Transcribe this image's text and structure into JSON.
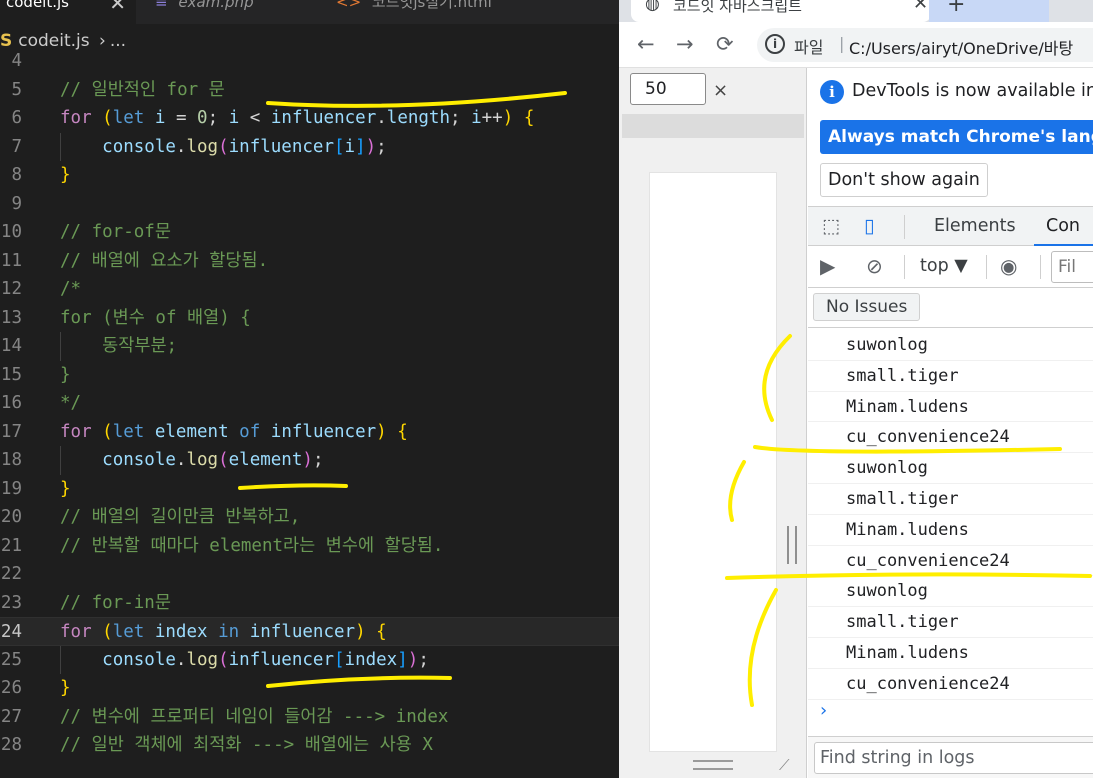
{
  "editor": {
    "tabs": [
      {
        "label": "codeit.js",
        "close": "✕",
        "active": true
      },
      {
        "label": "exam.php",
        "icon": "php-icon",
        "active": false
      },
      {
        "label": "코드잇js실기.html",
        "icon": "html-icon",
        "active": false
      }
    ],
    "breadcrumb": {
      "file": "codeit.js",
      "sep": "›",
      "rest": "..."
    },
    "lines": [
      {
        "n": "4"
      },
      {
        "n": "5"
      },
      {
        "n": "6"
      },
      {
        "n": "7"
      },
      {
        "n": "8"
      },
      {
        "n": "9"
      },
      {
        "n": "10"
      },
      {
        "n": "11"
      },
      {
        "n": "12"
      },
      {
        "n": "13"
      },
      {
        "n": "14"
      },
      {
        "n": "15"
      },
      {
        "n": "16"
      },
      {
        "n": "17"
      },
      {
        "n": "18"
      },
      {
        "n": "19"
      },
      {
        "n": "20"
      },
      {
        "n": "21"
      },
      {
        "n": "22"
      },
      {
        "n": "23"
      },
      {
        "n": "24"
      },
      {
        "n": "25"
      },
      {
        "n": "26"
      },
      {
        "n": "27"
      },
      {
        "n": "28"
      }
    ],
    "code": {
      "c5": "// 일반적인 for 문",
      "c10": "// for-of문",
      "c11": "// 배열에 요소가 할당됨.",
      "c12": "/*",
      "c13": "for (변수 of 배열) {",
      "c14": "    동작부분;",
      "c15": "}",
      "c16": "*/",
      "c20": "// 배열의 길이만큼 반복하고,",
      "c21": "// 반복할 때마다 element라는 변수에 할당됨.",
      "c23": "// for-in문",
      "c27": "// 변수에 프로퍼티 네임이 들어감 ---> index",
      "c28": "// 일반 객체에 최적화 ---> 배열에는 사용 X"
    }
  },
  "browser": {
    "tab_title": "코드잇 자바스크립트",
    "tab_close": "✕",
    "new_tab": "+",
    "nav": {
      "back": "←",
      "forward": "→",
      "reload": "⟳"
    },
    "url_label": "파일",
    "url": "C:/Users/airyt/OneDrive/바탕",
    "zoom": "50",
    "zoom_close": "×"
  },
  "devtools": {
    "notice": "DevTools is now available in",
    "match_button": "Always match Chrome's langu",
    "dont_show": "Don't show again",
    "tabs": [
      "Elements",
      "Con"
    ],
    "context": "top ▼",
    "filter_placeholder": "Fil",
    "issues": "No Issues",
    "logs": [
      "suwonlog",
      "small.tiger",
      "Minam.ludens",
      "cu_convenience24",
      "suwonlog",
      "small.tiger",
      "Minam.ludens",
      "cu_convenience24",
      "suwonlog",
      "small.tiger",
      "Minam.ludens",
      "cu_convenience24"
    ],
    "prompt": "›",
    "find_placeholder": "Find string in logs"
  },
  "colors": {
    "annotation": "#ffee00",
    "accent": "#1a73e8",
    "editor_bg": "#1e1e1e"
  }
}
